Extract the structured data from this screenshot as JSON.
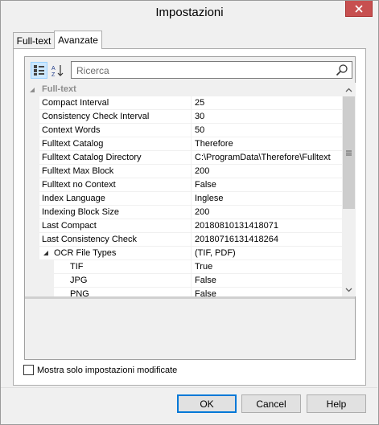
{
  "window": {
    "title": "Impostazioni",
    "close_icon": "close-icon"
  },
  "tabs": [
    {
      "label": "Full-text",
      "active": false
    },
    {
      "label": "Avanzate",
      "active": true
    }
  ],
  "toolbar": {
    "categorized_icon": "categorized-view-icon",
    "alphabetical_icon": "alphabetical-sort-icon",
    "search_placeholder": "Ricerca",
    "search_icon": "search-icon"
  },
  "grid": {
    "category": "Full-text",
    "rows": [
      {
        "name": "Compact Interval",
        "value": "25"
      },
      {
        "name": "Consistency Check Interval",
        "value": "30"
      },
      {
        "name": "Context Words",
        "value": "50"
      },
      {
        "name": "Fulltext Catalog",
        "value": "Therefore"
      },
      {
        "name": "Fulltext Catalog Directory",
        "value": "C:\\ProgramData\\Therefore\\Fulltext"
      },
      {
        "name": "Fulltext Max Block",
        "value": "200"
      },
      {
        "name": "Fulltext no Context",
        "value": "False"
      },
      {
        "name": "Index Language",
        "value": "Inglese"
      },
      {
        "name": "Indexing Block Size",
        "value": "200"
      },
      {
        "name": "Last Compact",
        "value": "20180810131418071"
      },
      {
        "name": "Last Consistency Check",
        "value": "20180716131418264"
      },
      {
        "name": "OCR File Types",
        "value": "(TIF, PDF)"
      }
    ],
    "ocr_children": [
      {
        "name": "TIF",
        "value": "True"
      },
      {
        "name": "JPG",
        "value": "False"
      },
      {
        "name": "PNG",
        "value": "False"
      }
    ]
  },
  "options": {
    "show_modified_only_label": "Mostra solo impostazioni modificate",
    "checked": false
  },
  "buttons": {
    "ok": "OK",
    "cancel": "Cancel",
    "help": "Help"
  }
}
